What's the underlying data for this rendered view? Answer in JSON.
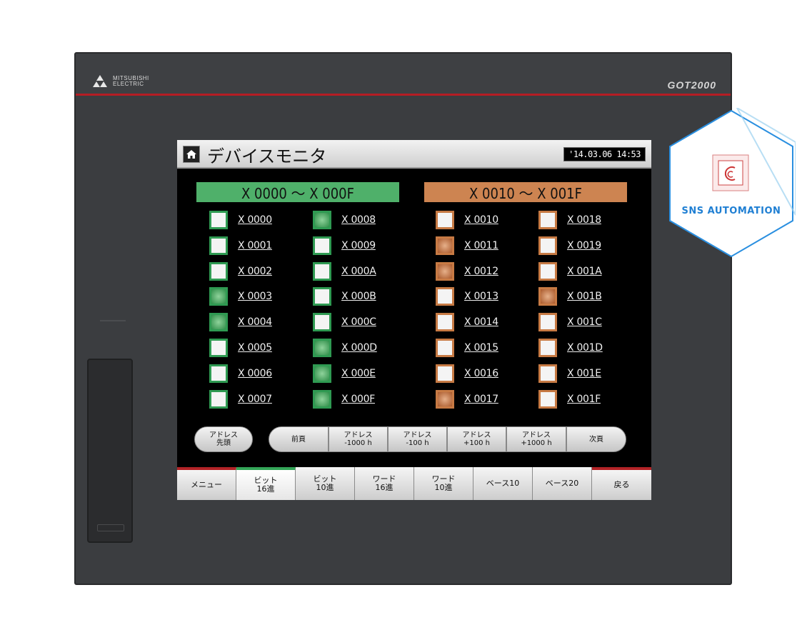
{
  "device": {
    "brand_line1": "MITSUBISHI",
    "brand_line2": "ELECTRIC",
    "model": "GOT2000"
  },
  "screen": {
    "title": "デバイスモニタ",
    "datetime": "'14.03.06 14:53",
    "groups": [
      {
        "header": "X 0000 ～ X 000F",
        "color": "#4fb06a",
        "columns": [
          [
            {
              "label": "X 0000",
              "on": false
            },
            {
              "label": "X 0001",
              "on": false
            },
            {
              "label": "X 0002",
              "on": false
            },
            {
              "label": "X 0003",
              "on": true
            },
            {
              "label": "X 0004",
              "on": true
            },
            {
              "label": "X 0005",
              "on": false
            },
            {
              "label": "X 0006",
              "on": false
            },
            {
              "label": "X 0007",
              "on": false
            }
          ],
          [
            {
              "label": "X 0008",
              "on": true
            },
            {
              "label": "X 0009",
              "on": false
            },
            {
              "label": "X 000A",
              "on": false
            },
            {
              "label": "X 000B",
              "on": false
            },
            {
              "label": "X 000C",
              "on": false
            },
            {
              "label": "X 000D",
              "on": true
            },
            {
              "label": "X 000E",
              "on": true
            },
            {
              "label": "X 000F",
              "on": true
            }
          ]
        ]
      },
      {
        "header": "X 0010 ～ X 001F",
        "color": "#cd8451",
        "columns": [
          [
            {
              "label": "X 0010",
              "on": false
            },
            {
              "label": "X 0011",
              "on": true
            },
            {
              "label": "X 0012",
              "on": true
            },
            {
              "label": "X 0013",
              "on": false
            },
            {
              "label": "X 0014",
              "on": false
            },
            {
              "label": "X 0015",
              "on": false
            },
            {
              "label": "X 0016",
              "on": false
            },
            {
              "label": "X 0017",
              "on": true
            }
          ],
          [
            {
              "label": "X 0018",
              "on": false
            },
            {
              "label": "X 0019",
              "on": false
            },
            {
              "label": "X 001A",
              "on": false
            },
            {
              "label": "X 001B",
              "on": true
            },
            {
              "label": "X 001C",
              "on": false
            },
            {
              "label": "X 001D",
              "on": false
            },
            {
              "label": "X 001E",
              "on": false
            },
            {
              "label": "X 001F",
              "on": false
            }
          ]
        ]
      }
    ],
    "nav_buttons": {
      "address_top": "アドレス\n先頭",
      "prev_page": "前頁",
      "addr_minus_1000": "アドレス\n-1000 h",
      "addr_minus_100": "アドレス\n-100 h",
      "addr_plus_100": "アドレス\n+100 h",
      "addr_plus_1000": "アドレス\n+1000 h",
      "next_page": "次頁"
    },
    "tabs": [
      {
        "label": "メニュー"
      },
      {
        "label": "ビット\n16進"
      },
      {
        "label": "ビット\n10進"
      },
      {
        "label": "ワード\n16進"
      },
      {
        "label": "ワード\n10進"
      },
      {
        "label": "ベース10"
      },
      {
        "label": "ベース20"
      },
      {
        "label": "戻る"
      }
    ],
    "active_tab": "ビット\n16進"
  },
  "watermark": {
    "text": "SNS AUTOMATION",
    "color": "#1f7fd3"
  }
}
